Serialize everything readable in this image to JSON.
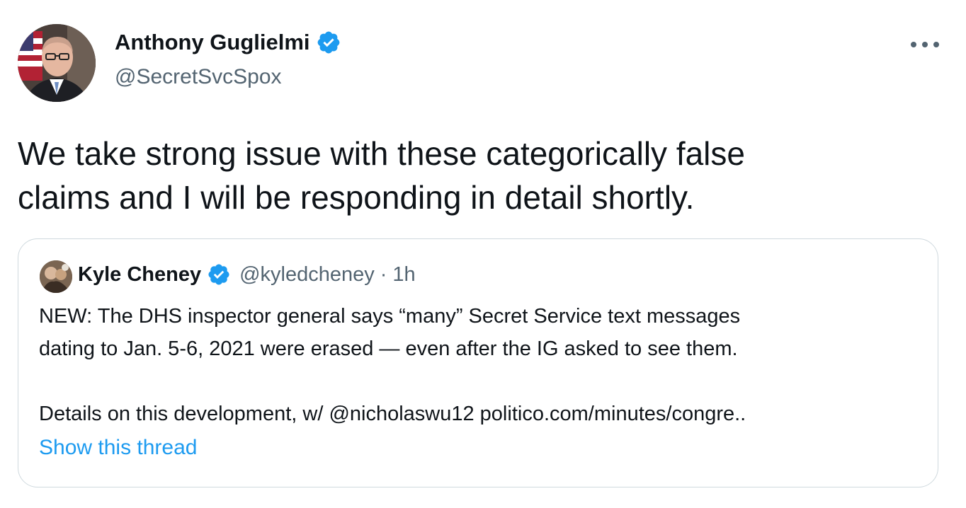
{
  "author": {
    "name": "Anthony Guglielmi",
    "handle": "@SecretSvcSpox",
    "verified_icon": "verified-badge-icon"
  },
  "more_icon": "more-options-icon",
  "tweet": {
    "text_line1": "We take strong issue with these categorically false",
    "text_line2": "claims and I will be responding in detail shortly."
  },
  "quote": {
    "author_name": "Kyle Cheney",
    "handle": "@kyledcheney",
    "separator": "·",
    "time": "1h",
    "line1": "NEW: The DHS inspector general says “many” Secret Service text messages",
    "line2": "dating to Jan. 5-6, 2021 were erased — even after the IG asked to see them.",
    "line3_prefix": "Details on this development, w/ ",
    "mention": "@nicholaswu12",
    "link": "politico.com/minutes/congre..",
    "show_thread": "Show this thread"
  },
  "colors": {
    "text": "#0f1419",
    "secondary": "#536471",
    "accent": "#1d9bf0",
    "border": "#cfd9de"
  }
}
